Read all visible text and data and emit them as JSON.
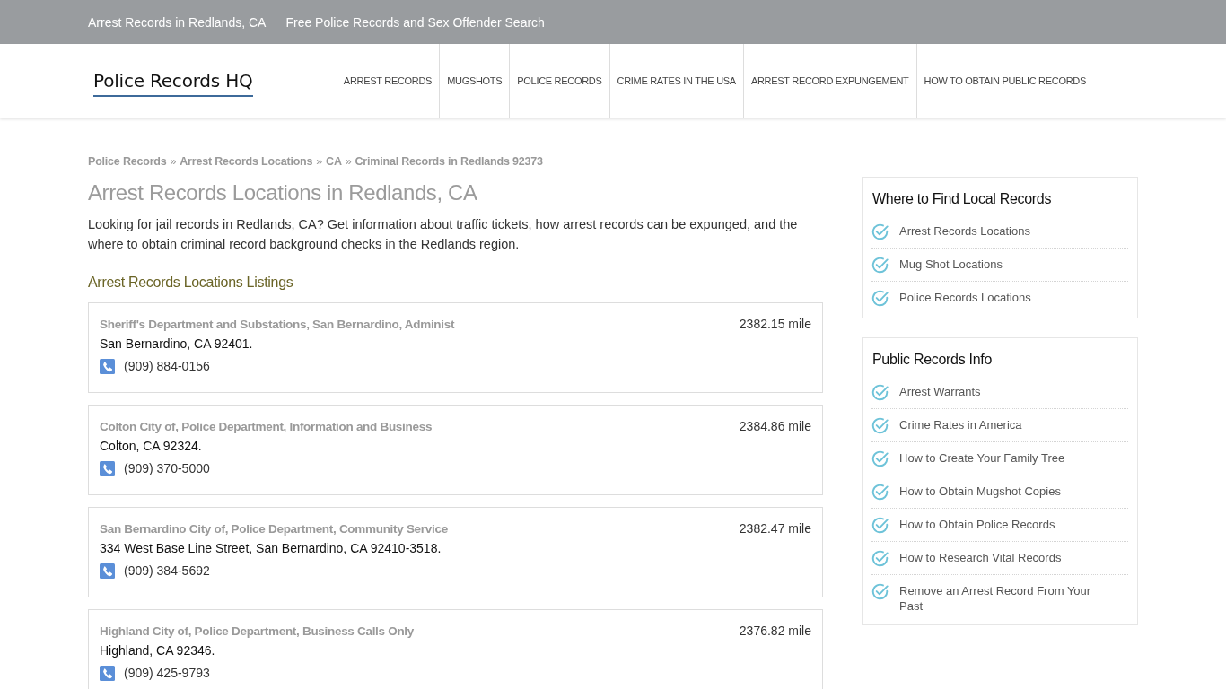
{
  "top_bar": {
    "links": [
      "Arrest Records in Redlands, CA",
      "Free Police Records and Sex Offender Search"
    ]
  },
  "header": {
    "logo": "Police Records HQ",
    "nav": [
      "ARREST RECORDS",
      "MUGSHOTS",
      "POLICE RECORDS",
      "CRIME RATES IN THE USA",
      "ARREST RECORD EXPUNGEMENT",
      "HOW TO OBTAIN PUBLIC RECORDS"
    ]
  },
  "breadcrumb": {
    "separator": "»",
    "items": [
      "Police Records",
      "Arrest Records Locations",
      "CA",
      "Criminal Records in Redlands 92373"
    ]
  },
  "page": {
    "title": "Arrest Records Locations in Redlands, CA",
    "intro": "Looking for jail records in Redlands, CA? Get information about traffic tickets, how arrest records can be expunged, and the where to obtain criminal record background checks in the Redlands region.",
    "listings_heading": "Arrest Records Locations Listings"
  },
  "listings": [
    {
      "name": "Sheriff's Department and Substations, San Bernardino, Administ",
      "distance": "2382.15 mile",
      "address": "San Bernardino, CA 92401.",
      "phone": "(909) 884-0156"
    },
    {
      "name": "Colton City of, Police Department, Information and Business",
      "distance": "2384.86 mile",
      "address": "Colton, CA 92324.",
      "phone": "(909) 370-5000"
    },
    {
      "name": "San Bernardino City of, Police Department, Community Service",
      "distance": "2382.47 mile",
      "address": "334 West Base Line Street, San Bernardino, CA 92410-3518.",
      "phone": "(909) 384-5692"
    },
    {
      "name": "Highland City of, Police Department, Business Calls Only",
      "distance": "2376.82 mile",
      "address": "Highland, CA 92346.",
      "phone": "(909) 425-9793"
    }
  ],
  "sidebar": {
    "widgets": [
      {
        "title": "Where to Find Local Records",
        "items": [
          "Arrest Records Locations",
          "Mug Shot Locations",
          "Police Records Locations"
        ]
      },
      {
        "title": "Public Records Info",
        "items": [
          "Arrest Warrants",
          "Crime Rates in America",
          "How to Create Your Family Tree",
          "How to Obtain Mugshot Copies",
          "How to Obtain Police Records",
          "How to Research Vital Records",
          "Remove an Arrest Record From Your Past"
        ]
      }
    ]
  }
}
